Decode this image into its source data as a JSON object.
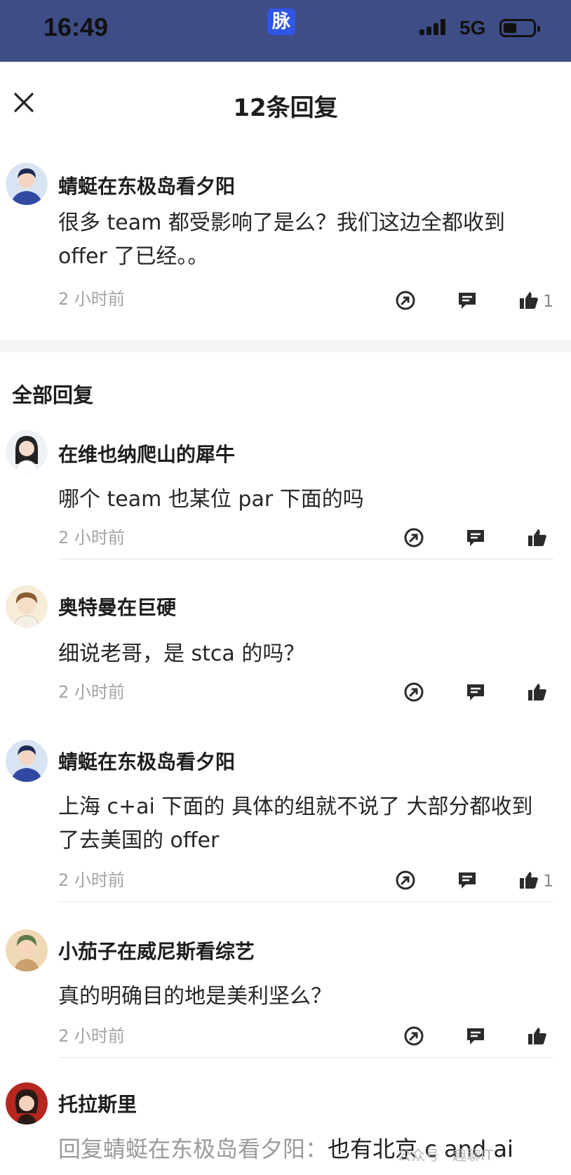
{
  "status_bar": {
    "time": "16:49",
    "app_icon_label": "脉",
    "network": "5G",
    "colors": {
      "background": "#3e4d86",
      "app_icon": "#2f56e6"
    }
  },
  "header": {
    "title": "12条回复",
    "close_icon": "close-icon"
  },
  "main_comment": {
    "author": "蜻蜓在东极岛看夕阳",
    "content": "很多 team 都受影响了是么？我们这边全都收到 offer 了已经。。",
    "time": "2 小时前",
    "like_count": "1"
  },
  "section_title": "全部回复",
  "replies": [
    {
      "author": "在维也纳爬山的犀牛",
      "content": "哪个 team 也某位 par 下面的吗",
      "time": "2 小时前",
      "like_count": ""
    },
    {
      "author": "奥特曼在巨硬",
      "content": "细说老哥，是 stca 的吗？",
      "time": "2 小时前",
      "like_count": ""
    },
    {
      "author": "蜻蜓在东极岛看夕阳",
      "content": "上海 c+ai 下面的 具体的组就不说了 大部分都收到了去美国的 offer",
      "time": "2 小时前",
      "like_count": "1"
    },
    {
      "author": "小茄子在威尼斯看综艺",
      "content": "真的明确目的地是美利坚么？",
      "time": "2 小时前",
      "like_count": ""
    },
    {
      "author": "托拉斯里",
      "reply_prefix": "回复蜻蜓在东极岛看夕阳：",
      "content": "也有北京 c and ai"
    }
  ],
  "watermark": "公众号 · 趣聊IT",
  "icons": [
    "share-icon",
    "comment-icon",
    "like-icon"
  ]
}
